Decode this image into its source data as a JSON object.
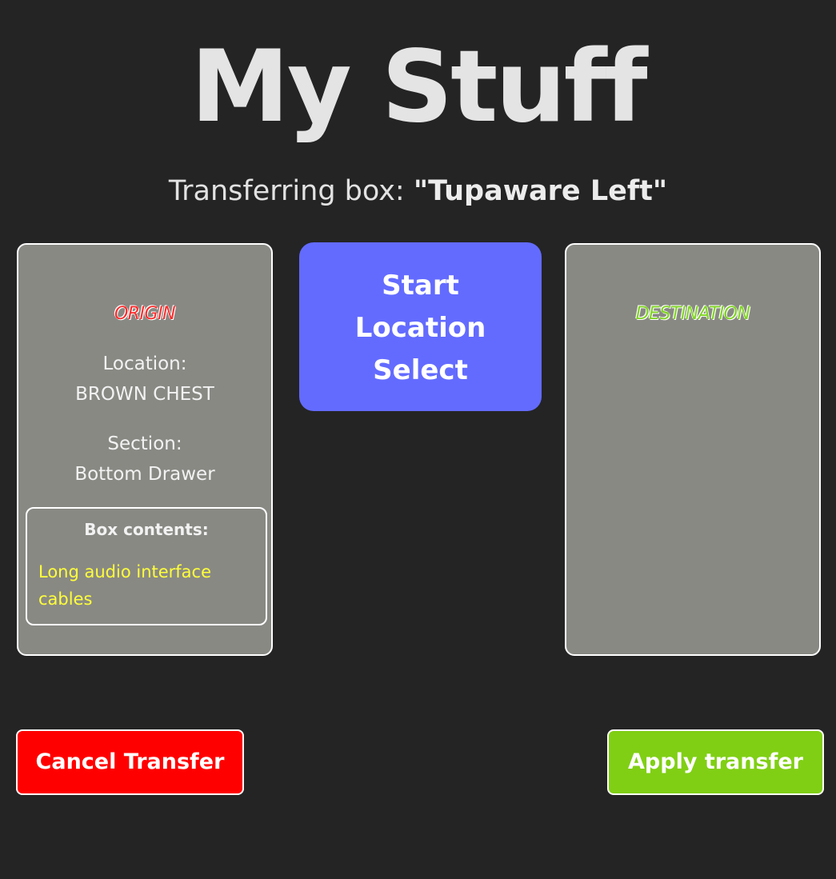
{
  "header": {
    "title": "My Stuff",
    "subtitle_prefix": "Transferring box: ",
    "box_name": "\"Tupaware Left\""
  },
  "origin": {
    "heading": "ORIGIN",
    "location_label": "Location:",
    "location_value": "BROWN CHEST",
    "section_label": "Section:",
    "section_value": "Bottom Drawer",
    "contents_heading": "Box contents:",
    "contents_item": "Long audio interface cables"
  },
  "destination": {
    "heading": "DESTINATION"
  },
  "actions": {
    "start_label": "Start Location Select",
    "cancel_label": "Cancel Transfer",
    "apply_label": "Apply transfer"
  },
  "colors": {
    "background": "#242424",
    "panel": "#898984",
    "start_button": "#636bff",
    "cancel_button": "#ff0000",
    "apply_button": "#80cf14",
    "origin_heading": "#ff2a2a",
    "destination_heading": "#7ed321",
    "contents_text": "#ffff3a"
  }
}
